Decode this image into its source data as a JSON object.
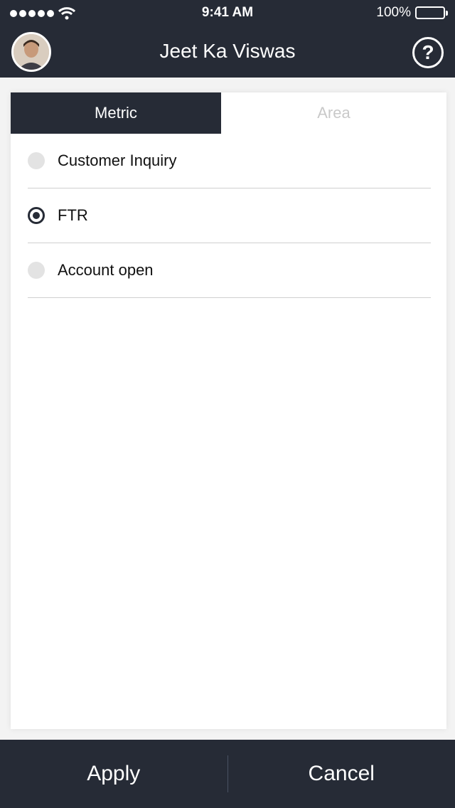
{
  "status_bar": {
    "time": "9:41 AM",
    "battery": "100%"
  },
  "header": {
    "user_name": "Jeet Ka Viswas",
    "help_icon": "?"
  },
  "tabs": [
    {
      "label": "Metric",
      "active": true
    },
    {
      "label": "Area",
      "active": false
    }
  ],
  "options": [
    {
      "label": "Customer Inquiry",
      "selected": false
    },
    {
      "label": "FTR",
      "selected": true
    },
    {
      "label": "Account open",
      "selected": false
    }
  ],
  "footer": {
    "apply_label": "Apply",
    "cancel_label": "Cancel"
  },
  "colors": {
    "primary": "#262b36",
    "inactive_tab_text": "#c9c9c9",
    "radio_unselected": "#e3e3e3"
  }
}
